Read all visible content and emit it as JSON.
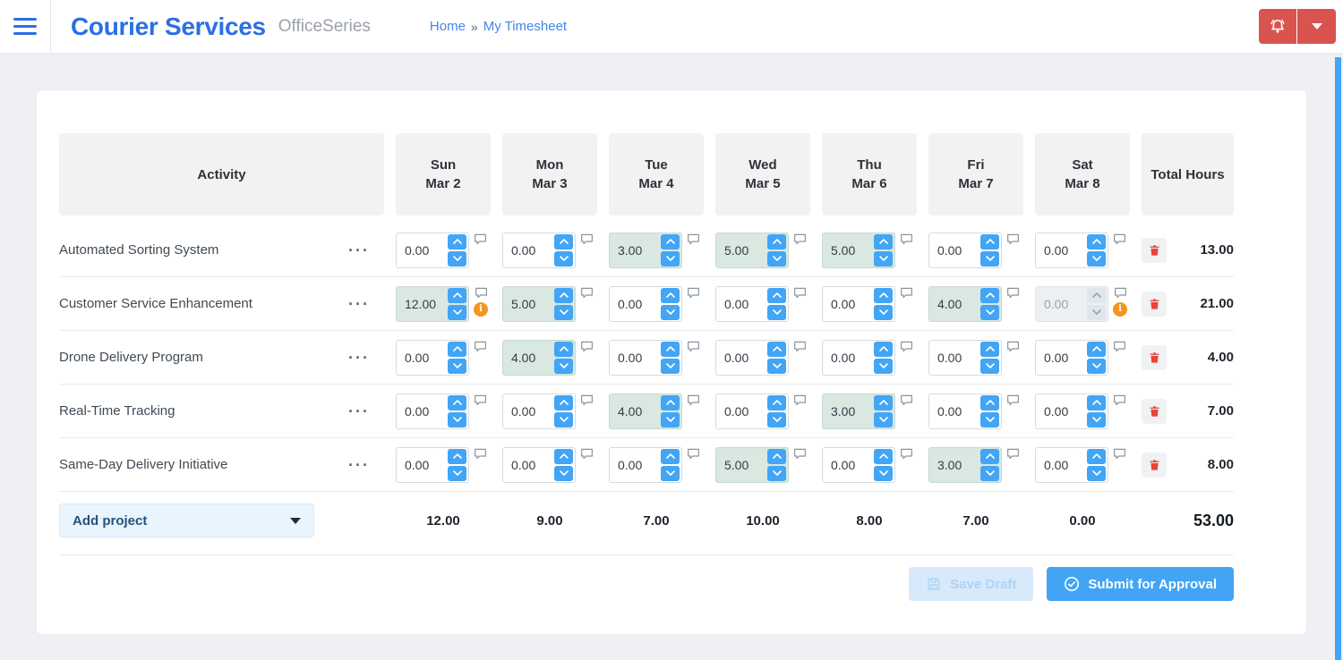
{
  "header": {
    "brand": "Courier Services",
    "suite": "OfficeSeries",
    "breadcrumb": {
      "home": "Home",
      "separator": "»",
      "current": "My Timesheet"
    }
  },
  "icons": {
    "hamburger": "three-bars",
    "bell": "notification-bell",
    "caret_down": "caret-down-triangle",
    "row_menu": "···",
    "comment": "speech-bubble",
    "warning": "i",
    "trash": "trash-can",
    "save": "floppy-disk",
    "submit": "check-circle"
  },
  "timesheet": {
    "columns": {
      "activity": "Activity",
      "total": "Total Hours"
    },
    "days": [
      {
        "day": "Sun",
        "date": "Mar 2"
      },
      {
        "day": "Mon",
        "date": "Mar 3"
      },
      {
        "day": "Tue",
        "date": "Mar 4"
      },
      {
        "day": "Wed",
        "date": "Mar 5"
      },
      {
        "day": "Thu",
        "date": "Mar 6"
      },
      {
        "day": "Fri",
        "date": "Mar 7"
      },
      {
        "day": "Sat",
        "date": "Mar 8"
      }
    ],
    "rows": [
      {
        "name": "Automated Sorting System",
        "cells": [
          {
            "value": "0.00"
          },
          {
            "value": "0.00"
          },
          {
            "value": "3.00"
          },
          {
            "value": "5.00"
          },
          {
            "value": "5.00"
          },
          {
            "value": "0.00"
          },
          {
            "value": "0.00"
          }
        ],
        "total": "13.00"
      },
      {
        "name": "Customer Service Enhancement",
        "cells": [
          {
            "value": "12.00",
            "warning": true
          },
          {
            "value": "5.00"
          },
          {
            "value": "0.00"
          },
          {
            "value": "0.00"
          },
          {
            "value": "0.00"
          },
          {
            "value": "4.00"
          },
          {
            "value": "0.00",
            "disabled": true,
            "warning": true
          }
        ],
        "total": "21.00"
      },
      {
        "name": "Drone Delivery Program",
        "cells": [
          {
            "value": "0.00"
          },
          {
            "value": "4.00"
          },
          {
            "value": "0.00"
          },
          {
            "value": "0.00"
          },
          {
            "value": "0.00"
          },
          {
            "value": "0.00"
          },
          {
            "value": "0.00"
          }
        ],
        "total": "4.00"
      },
      {
        "name": "Real-Time Tracking",
        "cells": [
          {
            "value": "0.00"
          },
          {
            "value": "0.00"
          },
          {
            "value": "4.00"
          },
          {
            "value": "0.00"
          },
          {
            "value": "3.00"
          },
          {
            "value": "0.00"
          },
          {
            "value": "0.00"
          }
        ],
        "total": "7.00"
      },
      {
        "name": "Same-Day Delivery Initiative",
        "cells": [
          {
            "value": "0.00"
          },
          {
            "value": "0.00"
          },
          {
            "value": "0.00"
          },
          {
            "value": "5.00"
          },
          {
            "value": "0.00"
          },
          {
            "value": "3.00"
          },
          {
            "value": "0.00"
          }
        ],
        "total": "8.00"
      }
    ],
    "day_totals": [
      "12.00",
      "9.00",
      "7.00",
      "10.00",
      "8.00",
      "7.00",
      "0.00"
    ],
    "grand_total": "53.00",
    "add_project_label": "Add project"
  },
  "actions": {
    "save_draft": "Save Draft",
    "submit": "Submit for Approval"
  },
  "colors": {
    "brand_blue": "#2b6fe3",
    "accent_blue": "#42a5f5",
    "danger_red": "#d9534f",
    "highlight_green": "#d9e8e1",
    "warning_orange": "#f6941e"
  }
}
